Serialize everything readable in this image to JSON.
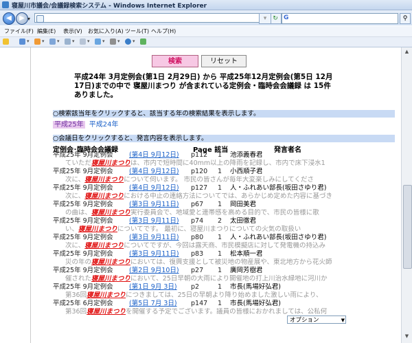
{
  "window": {
    "title": "寝屋川市議会/会議録検索システム - Windows Internet Explorer"
  },
  "menu": [
    "ファイル(F)",
    "編集(E)",
    "表示(V)",
    "お気に入り(A)",
    "ツール(T)",
    "ヘルプ(H)"
  ],
  "buttons": {
    "search": "検索",
    "reset": "リセット"
  },
  "summary": "平成24年 3月定例会(第1日 2月29日) から 平成25年12月定例会(第5日 12月17日)までの中で 寝屋川まつり が含まれている定例会・臨時会会議録 は 15件 ありました。",
  "year_hint": "○検索該当年をクリックすると、該当する年の検索結果を表示します。",
  "years": [
    "平成25年",
    "平成24年"
  ],
  "day_hint": "○会議日をクリックすると、発言内容を表示します。",
  "headers": {
    "meeting": "定例会･臨時会会議録",
    "page": "Page 該当",
    "speaker": "発言者名"
  },
  "rows": [
    {
      "meeting": "平成25年 9月定例会",
      "date": "(第4日 9月12日)",
      "page": "p112",
      "count": "1",
      "speaker": "池添義春君",
      "snippet_before": "ていただ",
      "keyword": "寝屋川まつり",
      "snippet_after": "は、市内で短時間に40mm以上の降雨を記録し、市内で床下浸水1"
    },
    {
      "meeting": "平成25年 9月定例会",
      "date": "(第4日 9月12日)",
      "page": "p120",
      "count": "1",
      "speaker": "小西順子君",
      "snippet_before": "次に、",
      "keyword": "寝屋川まつり",
      "snippet_after": "について伺います。 市民の皆さんが毎年大変楽しみにしてくださ"
    },
    {
      "meeting": "平成25年 9月定例会",
      "date": "(第4日 9月12日)",
      "page": "p127",
      "count": "1",
      "speaker": "人・ふれあい部長(坂田さゆり君)",
      "snippet_before": "次に、",
      "keyword": "寝屋川まつり",
      "snippet_after": "における中止の連絡方法についてでは、あらかじめ定めた内容に基づき"
    },
    {
      "meeting": "平成25年 9月定例会",
      "date": "(第3日 9月11日)",
      "page": "p67",
      "count": "1",
      "speaker": "岡田美君",
      "snippet_before": "の曲は、",
      "keyword": "寝屋川まつり",
      "snippet_after": "実行委員会で、地域愛と連帯感を高める目的で、市民の皆様に歌"
    },
    {
      "meeting": "平成25年 9月定例会",
      "date": "(第3日 9月11日)",
      "page": "p74",
      "count": "2",
      "speaker": "太田徹君",
      "snippet_before": "い、",
      "keyword": "寝屋川まつり",
      "snippet_after": "についてです。 最初に、寝屋川まつりについての火気の取扱い"
    },
    {
      "meeting": "平成25年 9月定例会",
      "date": "(第3日 9月11日)",
      "page": "p80",
      "count": "1",
      "speaker": "人・ふれあい部長(坂田さゆり君)",
      "snippet_before": "次に、",
      "keyword": "寝屋川まつり",
      "snippet_after": "についてですが、今回は露天商、市民模擬店に対して発電機の持込み"
    },
    {
      "meeting": "平成25年 9月定例会",
      "date": "(第3日 9月11日)",
      "page": "p83",
      "count": "1",
      "speaker": "松本順一君",
      "snippet_before": "災の年の",
      "keyword": "寝屋川まつり",
      "snippet_after": "においては、復興支援として被災地の物産展や、東北地方から花火師"
    },
    {
      "meeting": "平成25年 9月定例会",
      "date": "(第2日 9月10日)",
      "page": "p27",
      "count": "1",
      "speaker": "廣岡芳樹君",
      "snippet_before": "催された",
      "keyword": "寝屋川まつり",
      "snippet_after": "において、25日早朝の大雨により開催地の打上川治水緑地に河川か"
    },
    {
      "meeting": "平成25年 9月定例会",
      "date": "(第1日 9月 3日)",
      "page": "p2",
      "count": "1",
      "speaker": "市長(馬場好弘君)",
      "snippet_before": "第36回",
      "keyword": "寝屋川まつり",
      "snippet_after": "につきましては、25日の早朝より降り始めました激しい雨により、"
    },
    {
      "meeting": "平成25年 6月定例会",
      "date": "(第5日 7月 3日)",
      "page": "p147",
      "count": "1",
      "speaker": "市長(馬場好弘君)",
      "snippet_before": "第36回",
      "keyword": "寝屋川まつり",
      "snippet_after": "を開催する予定でございます。議員の皆様におかれましては、公私何"
    }
  ],
  "option_select": {
    "value": "オプション"
  }
}
